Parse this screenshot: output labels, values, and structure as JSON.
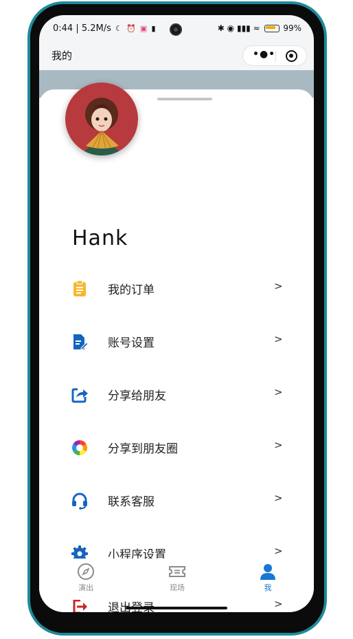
{
  "status": {
    "time": "0:44",
    "network_speed": "5.2M/s",
    "battery": "99%"
  },
  "navbar": {
    "title": "我的"
  },
  "profile": {
    "username": "Hank"
  },
  "menu": {
    "items": [
      {
        "label": "我的订单",
        "icon": "clipboard-icon",
        "color": "#f5b82e"
      },
      {
        "label": "账号设置",
        "icon": "edit-document-icon",
        "color": "#1565c0"
      },
      {
        "label": "分享给朋友",
        "icon": "share-icon",
        "color": "#1565c0"
      },
      {
        "label": "分享到朋友圈",
        "icon": "moments-icon",
        "color": "multicolor"
      },
      {
        "label": "联系客服",
        "icon": "headset-icon",
        "color": "#1565c0"
      },
      {
        "label": "小程序设置",
        "icon": "gear-icon",
        "color": "#1565c0"
      },
      {
        "label": "退出登录",
        "icon": "logout-icon",
        "color": "#c62828"
      }
    ],
    "arrow": ">"
  },
  "tabbar": {
    "tabs": [
      {
        "label": "演出",
        "icon": "compass-icon"
      },
      {
        "label": "现场",
        "icon": "ticket-icon"
      },
      {
        "label": "我",
        "icon": "person-icon",
        "active": true
      }
    ],
    "active_color": "#1976d2"
  },
  "colors": {
    "accent": "#1976d2",
    "phone_frame": "#1e8a9a",
    "header_band": "#a9b9c1"
  }
}
